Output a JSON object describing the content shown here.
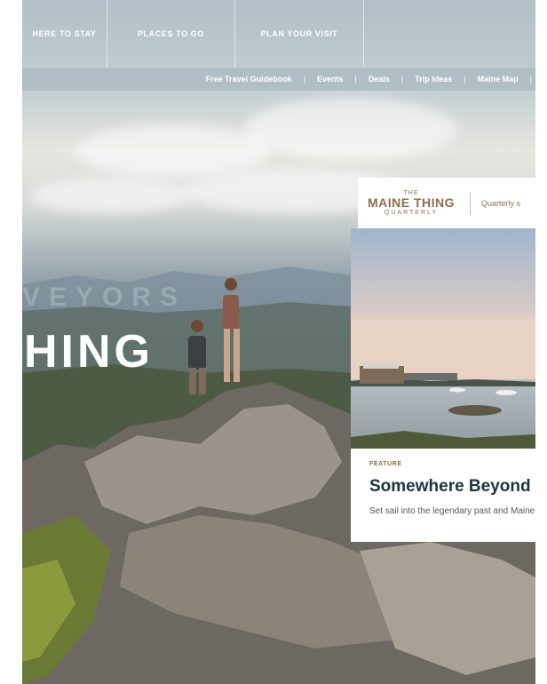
{
  "nav": {
    "primary": [
      "HERE TO STAY",
      "PLACES TO GO",
      "PLAN YOUR VISIT",
      ""
    ],
    "secondary": [
      "Free Travel Guidebook",
      "Events",
      "Deals",
      "Trip Ideas",
      "Maine Map"
    ],
    "separator": "|"
  },
  "hero": {
    "ghost_text": "VEYORS",
    "title": "HING"
  },
  "card": {
    "logo_the": "THE",
    "logo_main": "MAINE THING",
    "logo_quarterly": "QUARTERLY",
    "tagline": "Quarterly s",
    "eyebrow": "FEATURE",
    "title": "Somewhere Beyond",
    "description": "Set sail into the legendary past and Maine."
  },
  "colors": {
    "brand_gold": "#8a6f4a",
    "title_navy": "#1f3340"
  }
}
